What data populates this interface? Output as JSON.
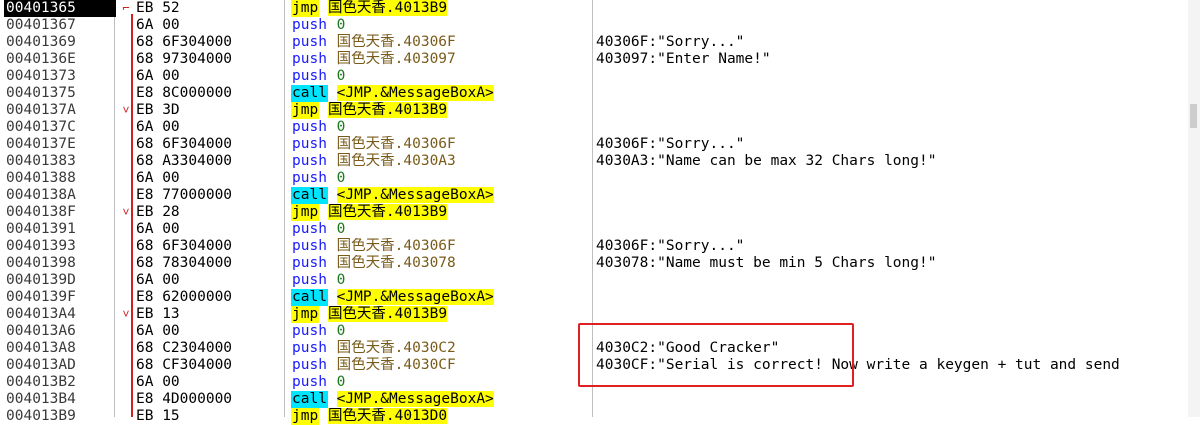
{
  "rows": [
    {
      "addr": "00401365",
      "arrow": "⌐",
      "bytes": "EB 52",
      "mnemonic": "jmp",
      "operand": "国色天香.4013B9",
      "comment": "",
      "selected": true
    },
    {
      "addr": "00401367",
      "arrow": "",
      "bytes": "6A 00",
      "mnemonic": "push",
      "operand": "0",
      "comment": ""
    },
    {
      "addr": "00401369",
      "arrow": "",
      "bytes": "68 6F304000",
      "mnemonic": "push",
      "operand": "国色天香.40306F",
      "comment": "40306F:\"Sorry...\""
    },
    {
      "addr": "0040136E",
      "arrow": "",
      "bytes": "68 97304000",
      "mnemonic": "push",
      "operand": "国色天香.403097",
      "comment": "403097:\"Enter Name!\""
    },
    {
      "addr": "00401373",
      "arrow": "",
      "bytes": "6A 00",
      "mnemonic": "push",
      "operand": "0",
      "comment": ""
    },
    {
      "addr": "00401375",
      "arrow": "",
      "bytes": "E8 8C000000",
      "mnemonic": "call",
      "operand": "<JMP.&MessageBoxA>",
      "comment": ""
    },
    {
      "addr": "0040137A",
      "arrow": "˅",
      "bytes": "EB 3D",
      "mnemonic": "jmp",
      "operand": "国色天香.4013B9",
      "comment": ""
    },
    {
      "addr": "0040137C",
      "arrow": "",
      "bytes": "6A 00",
      "mnemonic": "push",
      "operand": "0",
      "comment": ""
    },
    {
      "addr": "0040137E",
      "arrow": "",
      "bytes": "68 6F304000",
      "mnemonic": "push",
      "operand": "国色天香.40306F",
      "comment": "40306F:\"Sorry...\""
    },
    {
      "addr": "00401383",
      "arrow": "",
      "bytes": "68 A3304000",
      "mnemonic": "push",
      "operand": "国色天香.4030A3",
      "comment": "4030A3:\"Name can be max 32 Chars long!\""
    },
    {
      "addr": "00401388",
      "arrow": "",
      "bytes": "6A 00",
      "mnemonic": "push",
      "operand": "0",
      "comment": ""
    },
    {
      "addr": "0040138A",
      "arrow": "",
      "bytes": "E8 77000000",
      "mnemonic": "call",
      "operand": "<JMP.&MessageBoxA>",
      "comment": ""
    },
    {
      "addr": "0040138F",
      "arrow": "˅",
      "bytes": "EB 28",
      "mnemonic": "jmp",
      "operand": "国色天香.4013B9",
      "comment": ""
    },
    {
      "addr": "00401391",
      "arrow": "",
      "bytes": "6A 00",
      "mnemonic": "push",
      "operand": "0",
      "comment": ""
    },
    {
      "addr": "00401393",
      "arrow": "",
      "bytes": "68 6F304000",
      "mnemonic": "push",
      "operand": "国色天香.40306F",
      "comment": "40306F:\"Sorry...\""
    },
    {
      "addr": "00401398",
      "arrow": "",
      "bytes": "68 78304000",
      "mnemonic": "push",
      "operand": "国色天香.403078",
      "comment": "403078:\"Name must be min 5 Chars long!\""
    },
    {
      "addr": "0040139D",
      "arrow": "",
      "bytes": "6A 00",
      "mnemonic": "push",
      "operand": "0",
      "comment": ""
    },
    {
      "addr": "0040139F",
      "arrow": "",
      "bytes": "E8 62000000",
      "mnemonic": "call",
      "operand": "<JMP.&MessageBoxA>",
      "comment": ""
    },
    {
      "addr": "004013A4",
      "arrow": "˅",
      "bytes": "EB 13",
      "mnemonic": "jmp",
      "operand": "国色天香.4013B9",
      "comment": ""
    },
    {
      "addr": "004013A6",
      "arrow": "",
      "bytes": "6A 00",
      "mnemonic": "push",
      "operand": "0",
      "comment": ""
    },
    {
      "addr": "004013A8",
      "arrow": "",
      "bytes": "68 C2304000",
      "mnemonic": "push",
      "operand": "国色天香.4030C2",
      "comment": "4030C2:\"Good Cracker\""
    },
    {
      "addr": "004013AD",
      "arrow": "",
      "bytes": "68 CF304000",
      "mnemonic": "push",
      "operand": "国色天香.4030CF",
      "comment": "4030CF:\"Serial is correct! Now write a keygen + tut and send"
    },
    {
      "addr": "004013B2",
      "arrow": "",
      "bytes": "6A 00",
      "mnemonic": "push",
      "operand": "0",
      "comment": ""
    },
    {
      "addr": "004013B4",
      "arrow": "",
      "bytes": "E8 4D000000",
      "mnemonic": "call",
      "operand": "<JMP.&MessageBoxA>",
      "comment": ""
    },
    {
      "addr": "004013B9",
      "arrow": "",
      "bytes": "EB 15",
      "mnemonic": "jmp",
      "operand": "国色天香.4013D0",
      "comment": ""
    }
  ]
}
